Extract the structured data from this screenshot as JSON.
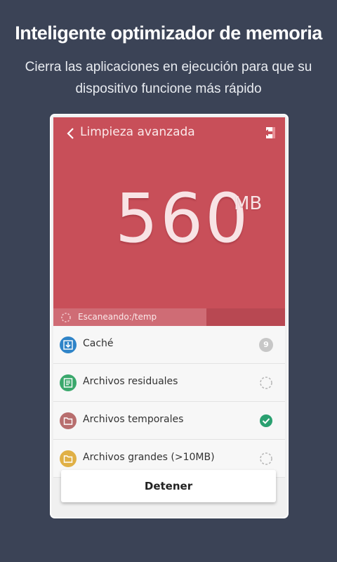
{
  "promo": {
    "title": "Inteligente optimizador de memoria",
    "subtitle": "Cierra las aplicaciones en ejecución para que su dispositivo funcione más rápido"
  },
  "screen": {
    "title": "Limpieza avanzada",
    "back_icon": "chevron-left-icon",
    "exit_icon": "exit-icon",
    "value": "560",
    "unit": "MB",
    "scan": {
      "text": "Escaneando:/temp",
      "progress_fraction": 0.66
    }
  },
  "items": [
    {
      "label": "Caché",
      "icon": "download-icon",
      "color": "#2f84c8",
      "status": "count",
      "count": "9"
    },
    {
      "label": "Archivos residuales",
      "icon": "document-icon",
      "color": "#3aa86c",
      "status": "loading"
    },
    {
      "label": "Archivos temporales",
      "icon": "folder-icon",
      "color": "#b86e6e",
      "status": "done"
    },
    {
      "label": "Archivos grandes (>10MB)",
      "icon": "folder-icon",
      "color": "#e0b046",
      "status": "loading"
    }
  ],
  "stop_button": "Detener",
  "colors": {
    "background": "#3b4356",
    "hero": "#c84f59",
    "check": "#2aa070"
  }
}
